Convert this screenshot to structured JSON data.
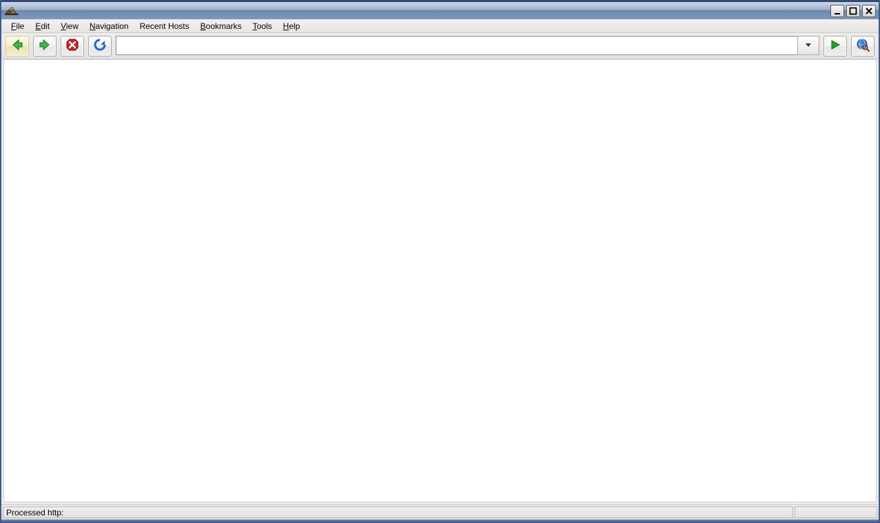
{
  "window": {
    "title": ""
  },
  "menubar": {
    "items": [
      {
        "label": "File",
        "mnemonic": "F"
      },
      {
        "label": "Edit",
        "mnemonic": "E"
      },
      {
        "label": "View",
        "mnemonic": "V"
      },
      {
        "label": "Navigation",
        "mnemonic": "N"
      },
      {
        "label": "Recent Hosts",
        "mnemonic": ""
      },
      {
        "label": "Bookmarks",
        "mnemonic": "B"
      },
      {
        "label": "Tools",
        "mnemonic": "T"
      },
      {
        "label": "Help",
        "mnemonic": "H"
      }
    ]
  },
  "toolbar": {
    "back": "back-arrow-icon",
    "forward": "forward-arrow-icon",
    "stop": "stop-icon",
    "refresh": "refresh-icon",
    "go": "go-icon",
    "search": "search-globe-icon",
    "address_value": "",
    "address_placeholder": ""
  },
  "statusbar": {
    "message": "Processed http:"
  }
}
